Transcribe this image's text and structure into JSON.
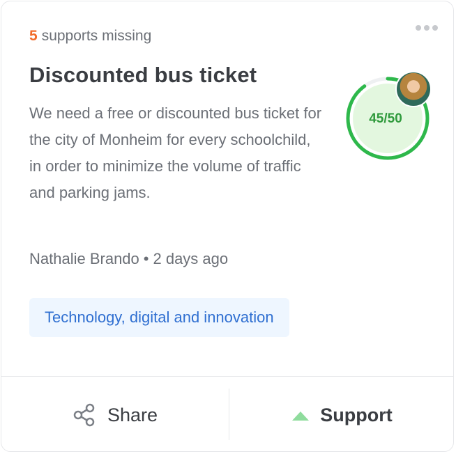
{
  "card": {
    "missing_count": "5",
    "missing_label": "supports missing",
    "title": "Discounted bus ticket",
    "description": "We need a free or discounted bus ticket for the city of Monheim for every schoolchild, in order to minimize the volume of traffic and parking jams.",
    "author": "Nathalie Brando",
    "separator": "•",
    "time": "2 days ago",
    "tag": "Technology, digital and innovation"
  },
  "progress": {
    "label": "45/50",
    "current": 45,
    "total": 50,
    "ring_color": "#2eb84b",
    "fill_color": "#e3f7df",
    "text_color": "#2f9a3c"
  },
  "actions": {
    "share_label": "Share",
    "support_label": "Support"
  },
  "icons": {
    "menu": "more-dots-icon",
    "share": "share-icon",
    "support": "triangle-up-icon"
  },
  "colors": {
    "accent_orange": "#f26b2a",
    "tag_text": "#2f6fd1",
    "tag_bg": "#eef6ff",
    "support_arrow": "#8fdc9d"
  }
}
